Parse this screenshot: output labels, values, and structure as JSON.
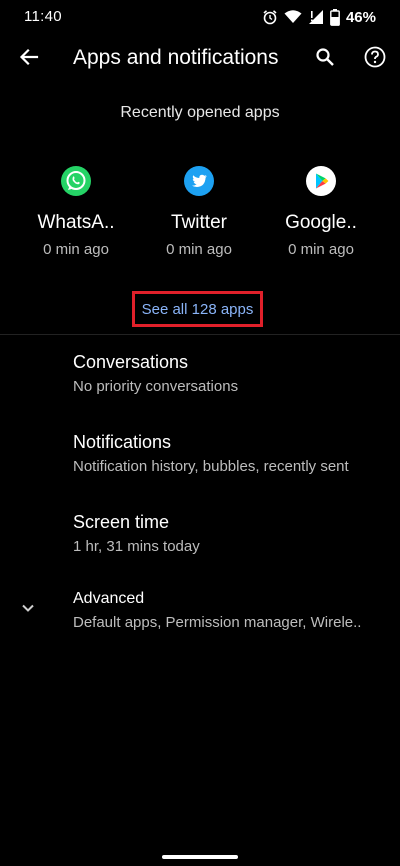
{
  "status_bar": {
    "time": "11:40",
    "battery_percent": "46%",
    "icons": [
      "alarm-icon",
      "wifi-icon",
      "signal-icon",
      "battery-icon"
    ]
  },
  "app_bar": {
    "title": "Apps and notifications",
    "icons": [
      "back-arrow-icon",
      "search-icon",
      "help-icon"
    ]
  },
  "recent_apps": {
    "heading": "Recently opened apps",
    "items": [
      {
        "name": "WhatsA..",
        "time": "0 min ago",
        "icon": "whatsapp-icon",
        "color": "#25d366"
      },
      {
        "name": "Twitter",
        "time": "0 min ago",
        "icon": "twitter-icon",
        "color": "#1da1f2"
      },
      {
        "name": "Google..",
        "time": "0 min ago",
        "icon": "google-play-icon",
        "color": "#ffffff"
      }
    ],
    "see_all_label": "See all 128 apps"
  },
  "settings": {
    "items": [
      {
        "title": "Conversations",
        "summary": "No priority conversations"
      },
      {
        "title": "Notifications",
        "summary": "Notification history, bubbles, recently sent"
      },
      {
        "title": "Screen time",
        "summary": "1 hr, 31 mins today"
      },
      {
        "title": "Advanced",
        "summary": "Default apps, Permission manager, Wirele..",
        "icon": "chevron-down-icon"
      }
    ]
  },
  "colors": {
    "background": "#000000",
    "link": "#8ab4f8",
    "highlight_box": "#e0202a",
    "secondary_text": "#bdbdbd"
  }
}
